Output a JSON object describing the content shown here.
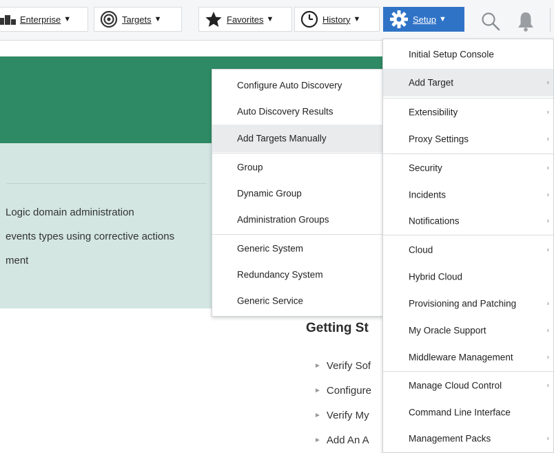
{
  "topbar": {
    "enterprise_label": "Enterprise",
    "targets_label": "Targets",
    "favorites_label": "Favorites",
    "history_label": "History",
    "setup_label": "Setup",
    "caret": "▼",
    "accent_color": "#2f73c7"
  },
  "page": {
    "lines": [
      "Logic domain administration",
      "events types using corrective actions",
      "ment"
    ],
    "getting_started_title": "Getting St",
    "getting_started_items": [
      "Verify Sof",
      "Configure",
      "Verify My",
      "Add An A"
    ]
  },
  "add_target_menu": {
    "items": [
      "Configure Auto Discovery",
      "Auto Discovery Results",
      "Add Targets Manually",
      "Group",
      "Dynamic Group",
      "Administration Groups",
      "Generic System",
      "Redundancy System",
      "Generic Service"
    ]
  },
  "setup_menu": {
    "items": [
      "Initial Setup Console",
      "Add Target",
      "Extensibility",
      "Proxy Settings",
      "Security",
      "Incidents",
      "Notifications",
      "Cloud",
      "Hybrid Cloud",
      "Provisioning and Patching",
      "My Oracle Support",
      "Middleware Management",
      "Manage Cloud Control",
      "Command Line Interface",
      "Management Packs"
    ]
  }
}
